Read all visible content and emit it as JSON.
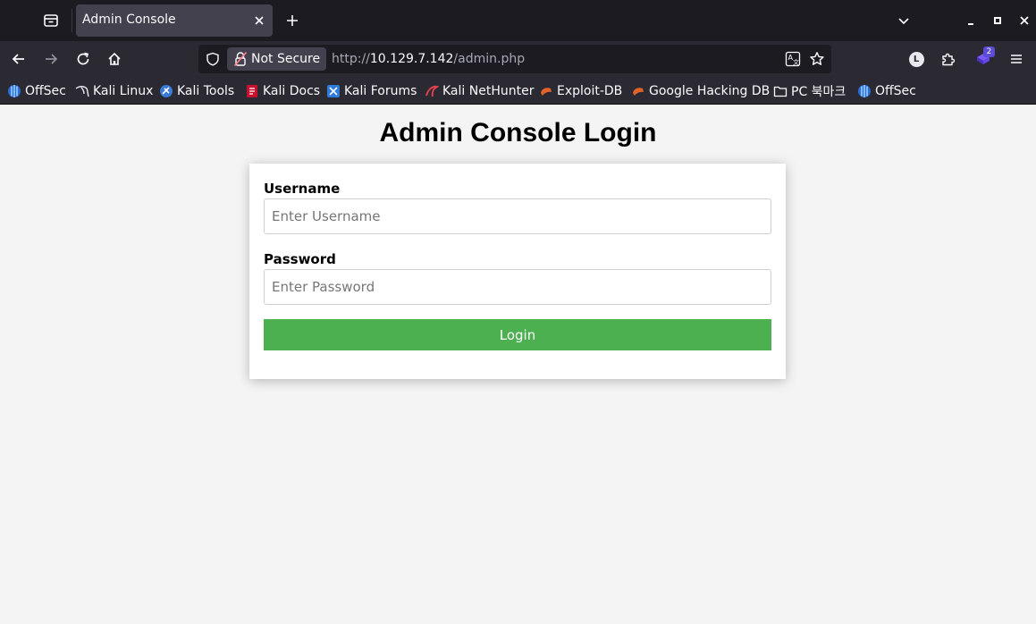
{
  "browser": {
    "tab": {
      "title": "Admin Console"
    },
    "urlbar": {
      "security_label": "Not Secure",
      "url_scheme": "http://",
      "url_host": "10.129.7.142",
      "url_path": "/admin.php"
    },
    "extension_badge": "2",
    "profile_initial": "L",
    "bookmarks": [
      {
        "label": "OffSec",
        "icon": "offsec-icon"
      },
      {
        "label": "Kali Linux",
        "icon": "kali-dragon-icon"
      },
      {
        "label": "Kali Tools",
        "icon": "kali-tools-icon"
      },
      {
        "label": "Kali Docs",
        "icon": "kali-docs-icon"
      },
      {
        "label": "Kali Forums",
        "icon": "kali-forums-icon"
      },
      {
        "label": "Kali NetHunter",
        "icon": "nethunter-icon"
      },
      {
        "label": "Exploit-DB",
        "icon": "exploitdb-icon"
      },
      {
        "label": "Google Hacking DB",
        "icon": "ghdb-icon"
      },
      {
        "label": "PC 북마크",
        "icon": "folder-icon"
      },
      {
        "label": "OffSec",
        "icon": "offsec-icon"
      }
    ]
  },
  "page": {
    "title": "Admin Console Login",
    "form": {
      "username_label": "Username",
      "username_placeholder": "Enter Username",
      "username_value": "",
      "password_label": "Password",
      "password_placeholder": "Enter Password",
      "password_value": "",
      "submit_label": "Login"
    }
  },
  "colors": {
    "tabstrip_bg": "#1c1b22",
    "toolbar_bg": "#2b2a33",
    "page_bg": "#f4f4f4",
    "login_button": "#4caf50"
  }
}
